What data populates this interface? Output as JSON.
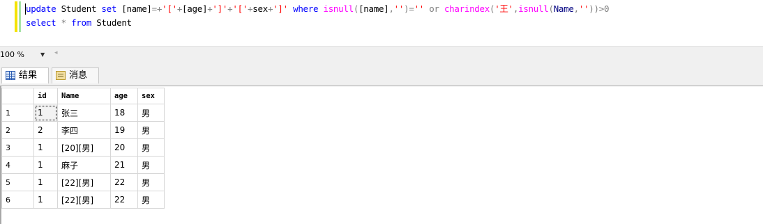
{
  "editor": {
    "line1": {
      "t1": "update",
      "t2": " Student ",
      "t3": "set",
      "t4": " [name]",
      "t5": "=+",
      "t6": "'['",
      "t7": "+",
      "t8": "[age]",
      "t9": "+",
      "t10": "']'",
      "t11": "+",
      "t12": "'['",
      "t13": "+",
      "t14": "sex",
      "t15": "+",
      "t16": "']'",
      "t17": " ",
      "t18": "where",
      "t19": " ",
      "t20": "isnull",
      "t21": "(",
      "t22": "[name]",
      "t23": ",",
      "t24": "''",
      "t25": ")=",
      "t26": "''",
      "t27": " or ",
      "t28": "charindex",
      "t29": "(",
      "t30": "'王'",
      "t31": ",",
      "t32": "isnull",
      "t33": "(",
      "t34": "Name",
      "t35": ",",
      "t36": "''",
      "t37": "))>0"
    },
    "line2": {
      "t1": "select",
      "t2": " ",
      "t3": "*",
      "t4": " ",
      "t5": "from",
      "t6": " Student"
    }
  },
  "zoom": {
    "value": "100 %"
  },
  "tabs": {
    "results": "结果",
    "messages": "消息"
  },
  "table": {
    "headers": [
      "id",
      "Name",
      "age",
      "sex"
    ],
    "rows": [
      {
        "num": "1",
        "id": "1",
        "name": "张三",
        "age": "18",
        "sex": "男"
      },
      {
        "num": "2",
        "id": "2",
        "name": "李四",
        "age": "19",
        "sex": "男"
      },
      {
        "num": "3",
        "id": "1",
        "name": "[20][男]",
        "age": "20",
        "sex": "男"
      },
      {
        "num": "4",
        "id": "1",
        "name": "麻子",
        "age": "21",
        "sex": "男"
      },
      {
        "num": "5",
        "id": "1",
        "name": "[22][男]",
        "age": "22",
        "sex": "男"
      },
      {
        "num": "6",
        "id": "1",
        "name": "[22][男]",
        "age": "22",
        "sex": "男"
      }
    ]
  },
  "colors": {
    "keyword": "#0000ff",
    "string": "#ff0000",
    "function": "#ff00ff",
    "operator": "#808080"
  }
}
